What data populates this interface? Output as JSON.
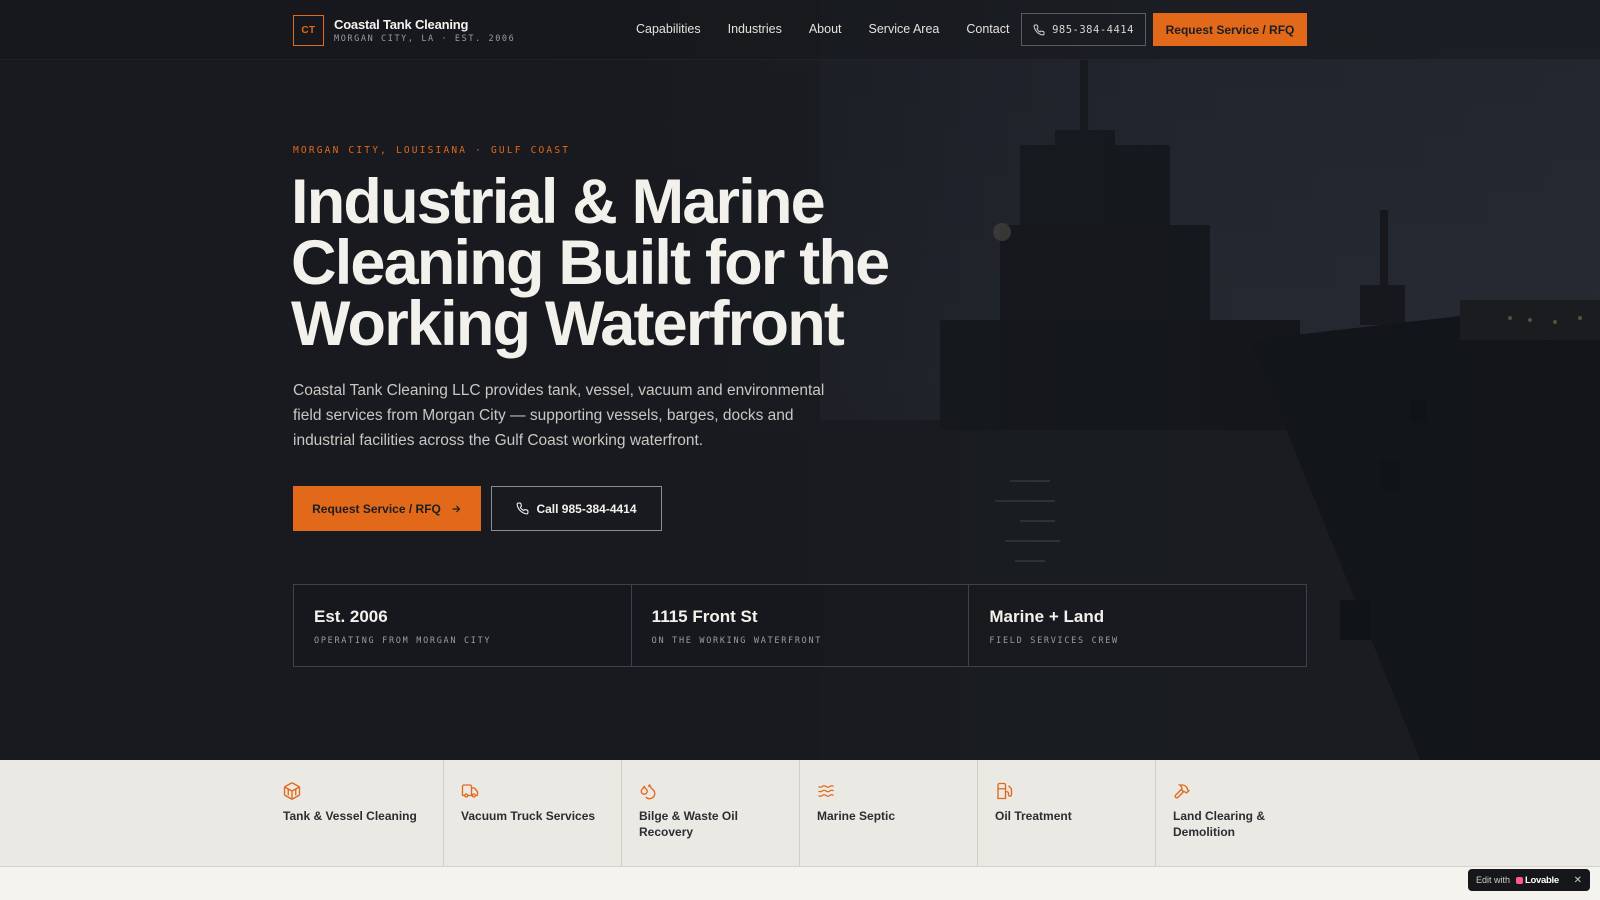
{
  "brand": {
    "mark": "CT",
    "name": "Coastal Tank Cleaning",
    "sub": "MORGAN CITY, LA · EST. 2006"
  },
  "nav": {
    "links": [
      "Capabilities",
      "Industries",
      "About",
      "Service Area",
      "Contact"
    ],
    "phone": "985-384-4414",
    "cta": "Request Service / RFQ"
  },
  "hero": {
    "eyebrow": "MORGAN CITY, LOUISIANA · GULF COAST",
    "headline": "Industrial & Marine Cleaning Built for the Working Waterfront",
    "lead": "Coastal Tank Cleaning LLC provides tank, vessel, vacuum and environmental field services from Morgan City — supporting vessels, barges, docks and industrial facilities across the Gulf Coast working waterfront.",
    "primary_button": "Request Service / RFQ",
    "secondary_button": "Call 985-384-4414"
  },
  "stats": [
    {
      "title": "Est. 2006",
      "sub": "OPERATING FROM MORGAN CITY"
    },
    {
      "title": "1115 Front St",
      "sub": "ON THE WORKING WATERFRONT"
    },
    {
      "title": "Marine + Land",
      "sub": "FIELD SERVICES CREW"
    }
  ],
  "services": [
    {
      "icon": "container-icon",
      "label": "Tank & Vessel Cleaning"
    },
    {
      "icon": "truck-icon",
      "label": "Vacuum Truck Services"
    },
    {
      "icon": "droplets-icon",
      "label": "Bilge & Waste Oil Recovery"
    },
    {
      "icon": "waves-icon",
      "label": "Marine Septic"
    },
    {
      "icon": "fuel-icon",
      "label": "Oil Treatment"
    },
    {
      "icon": "hammer-icon",
      "label": "Land Clearing & Demolition"
    }
  ],
  "badge": {
    "text": "Edit with",
    "brand": "Lovable",
    "close": "✕"
  },
  "colors": {
    "accent": "#e2681a",
    "dark": "#1b1d22",
    "light": "#ebe9e3"
  }
}
